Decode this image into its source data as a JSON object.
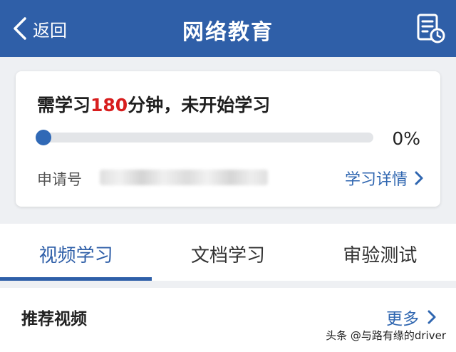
{
  "header": {
    "back_label": "返回",
    "title": "网络教育",
    "record_icon": "document-clock-icon"
  },
  "study_card": {
    "requirement_prefix": "需学习",
    "required_minutes": "180",
    "requirement_suffix": "分钟，未开始学习",
    "progress_value": 0,
    "progress_percent": "0%",
    "application_no_label": "申请号",
    "details_link": "学习详情"
  },
  "tabs": [
    {
      "label": "视频学习",
      "active": true
    },
    {
      "label": "文档学习",
      "active": false
    },
    {
      "label": "审验测试",
      "active": false
    }
  ],
  "section": {
    "title": "推荐视频",
    "more_label": "更多"
  },
  "watermark": "头条 @与路有缘的driver",
  "colors": {
    "brand": "#2f5fa8",
    "accent_red": "#d81e1e",
    "link": "#2f66b0"
  }
}
